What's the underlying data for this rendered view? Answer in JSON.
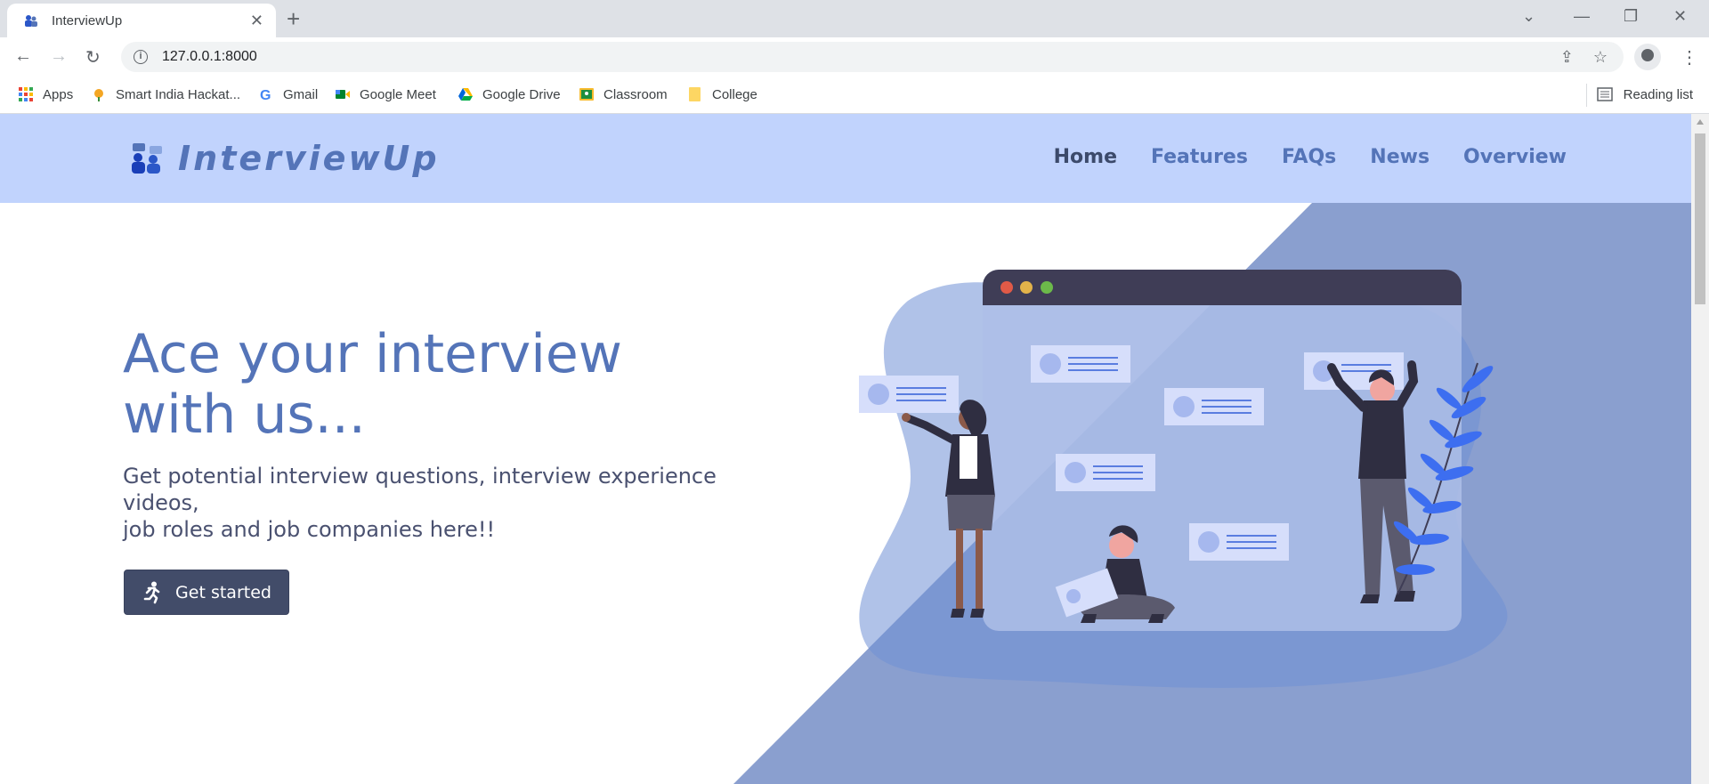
{
  "browser": {
    "tab_title": "InterviewUp",
    "url": "127.0.0.1:8000",
    "bookmarks": [
      {
        "label": "Apps",
        "icon": "apps-grid-icon"
      },
      {
        "label": "Smart India Hackat...",
        "icon": "sih-icon"
      },
      {
        "label": "Gmail",
        "icon": "google-icon"
      },
      {
        "label": "Google Meet",
        "icon": "google-meet-icon"
      },
      {
        "label": "Google Drive",
        "icon": "google-drive-icon"
      },
      {
        "label": "Classroom",
        "icon": "classroom-icon"
      },
      {
        "label": "College",
        "icon": "folder-icon"
      }
    ],
    "reading_list": "Reading list"
  },
  "site": {
    "brand": "InterviewUp",
    "nav": [
      "Home",
      "Features",
      "FAQs",
      "News",
      "Overview"
    ],
    "active_nav": "Home",
    "hero_title_line1": "Ace your interview",
    "hero_title_line2": "with us...",
    "hero_subtitle_line1": "Get potential interview questions, interview experience videos,",
    "hero_subtitle_line2": "job roles and job companies here!!",
    "cta_label": "Get started"
  },
  "colors": {
    "header_bg": "#c1d3fd",
    "brand": "#5474b8",
    "diagonal_bg": "#8a9fcf",
    "cta_bg": "#424c69"
  }
}
